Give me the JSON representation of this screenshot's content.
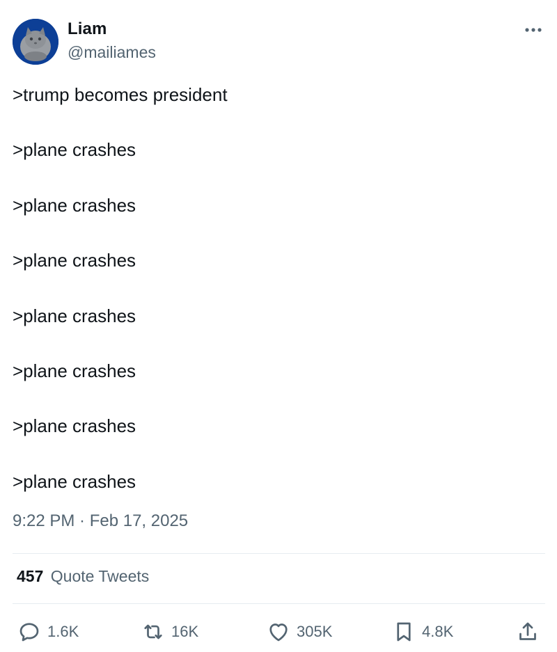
{
  "author": {
    "name": "Liam",
    "handle": "@mailiames",
    "avatar_icon": "cat-avatar",
    "avatar_bg": "#0d3f96"
  },
  "menu": {
    "icon": "more-horizontal-icon"
  },
  "tweet": {
    "lines": [
      ">trump becomes president",
      ">plane crashes",
      ">plane crashes",
      ">plane crashes",
      ">plane crashes",
      ">plane crashes",
      ">plane crashes",
      ">plane crashes"
    ],
    "timestamp": "9:22 PM · Feb 17, 2025"
  },
  "quotes": {
    "count": "457",
    "label": "Quote Tweets"
  },
  "actions": {
    "reply": {
      "icon": "reply-icon",
      "count": "1.6K"
    },
    "retweet": {
      "icon": "retweet-icon",
      "count": "16K"
    },
    "like": {
      "icon": "heart-icon",
      "count": "305K"
    },
    "bookmark": {
      "icon": "bookmark-icon",
      "count": "4.8K"
    },
    "share": {
      "icon": "share-icon"
    }
  },
  "colors": {
    "text": "#0f1419",
    "secondary": "#536471",
    "divider": "#e6ecf0"
  }
}
